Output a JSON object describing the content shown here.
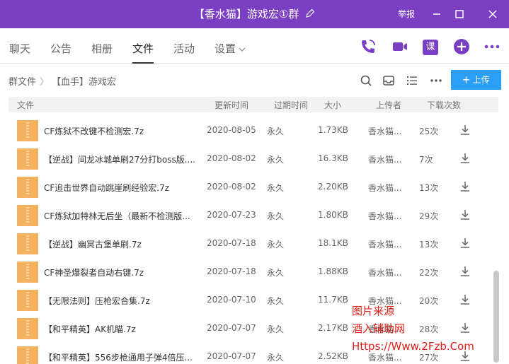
{
  "window": {
    "title": "【香水猫】游戏宏①群",
    "report_label": "举报"
  },
  "tabs": [
    {
      "label": "聊天"
    },
    {
      "label": "公告"
    },
    {
      "label": "相册"
    },
    {
      "label": "文件"
    },
    {
      "label": "活动"
    },
    {
      "label": "设置"
    }
  ],
  "toolbar": {
    "lesson_label": "课"
  },
  "breadcrumb": {
    "root": "群文件",
    "separator": "〉",
    "current": "【血手】游戏宏"
  },
  "upload_label": "上传",
  "table": {
    "columns": [
      "文件",
      "更新时间",
      "过期时间",
      "大小",
      "上传者",
      "下载次数"
    ],
    "rows": [
      {
        "name": "CF炼狱不改键不检测宏.7z",
        "date": "2020-08-05",
        "expire": "永久",
        "size": "1.73KB",
        "uploader": "香水猫...",
        "downloads": "25次"
      },
      {
        "name": "【逆战】间龙冰城单刷27分打boss版....",
        "date": "2020-08-02",
        "expire": "永久",
        "size": "16.3KB",
        "uploader": "香水猫...",
        "downloads": "7次"
      },
      {
        "name": "CF追击世界自动跳崖刷经验宏.7z",
        "date": "2020-08-02",
        "expire": "永久",
        "size": "2.20KB",
        "uploader": "香水猫...",
        "downloads": "13次"
      },
      {
        "name": "CF炼狱加特林无后坐（最新不检测版...",
        "date": "2020-07-23",
        "expire": "永久",
        "size": "1.80KB",
        "uploader": "香水猫...",
        "downloads": "29次"
      },
      {
        "name": "【逆战】幽冥古堡单刷.7z",
        "date": "2020-07-18",
        "expire": "永久",
        "size": "18.1KB",
        "uploader": "香水猫...",
        "downloads": "13次"
      },
      {
        "name": "CF神圣爆裂者自动右键.7z",
        "date": "2020-07-18",
        "expire": "永久",
        "size": "1.88KB",
        "uploader": "香水猫...",
        "downloads": "22次"
      },
      {
        "name": "【无限法则】压枪宏合集.7z",
        "date": "2020-07-10",
        "expire": "永久",
        "size": "11.7KB",
        "uploader": "香水猫...",
        "downloads": "20次"
      },
      {
        "name": "【和平精英】AK机瞄.7z",
        "date": "2020-07-07",
        "expire": "永久",
        "size": "2.17KB",
        "uploader": "香水猫...",
        "downloads": "28次"
      },
      {
        "name": "【和平精英】556步枪通用子弹4倍压...",
        "date": "2020-07-07",
        "expire": "永久",
        "size": "2.52KB",
        "uploader": "香水猫...",
        "downloads": "27次"
      }
    ]
  },
  "watermark": {
    "line1": "图片来源",
    "line2": "酒入辅助网",
    "line3": "Https://Www.2Fzb.Com"
  },
  "colors": {
    "title_bar": "#7b3fc4",
    "accent_blue": "#2a9ff5",
    "file_icon": "#f5b060",
    "watermark": "#e0201a"
  },
  "icons": [
    "edit-icon",
    "minimize-icon",
    "maximize-icon",
    "close-icon",
    "phone-icon",
    "video-icon",
    "lesson-icon",
    "add-icon",
    "more-icon",
    "search-icon",
    "inbox-icon",
    "list-view-icon",
    "more-dots-icon",
    "download-icon",
    "archive-file-icon"
  ]
}
